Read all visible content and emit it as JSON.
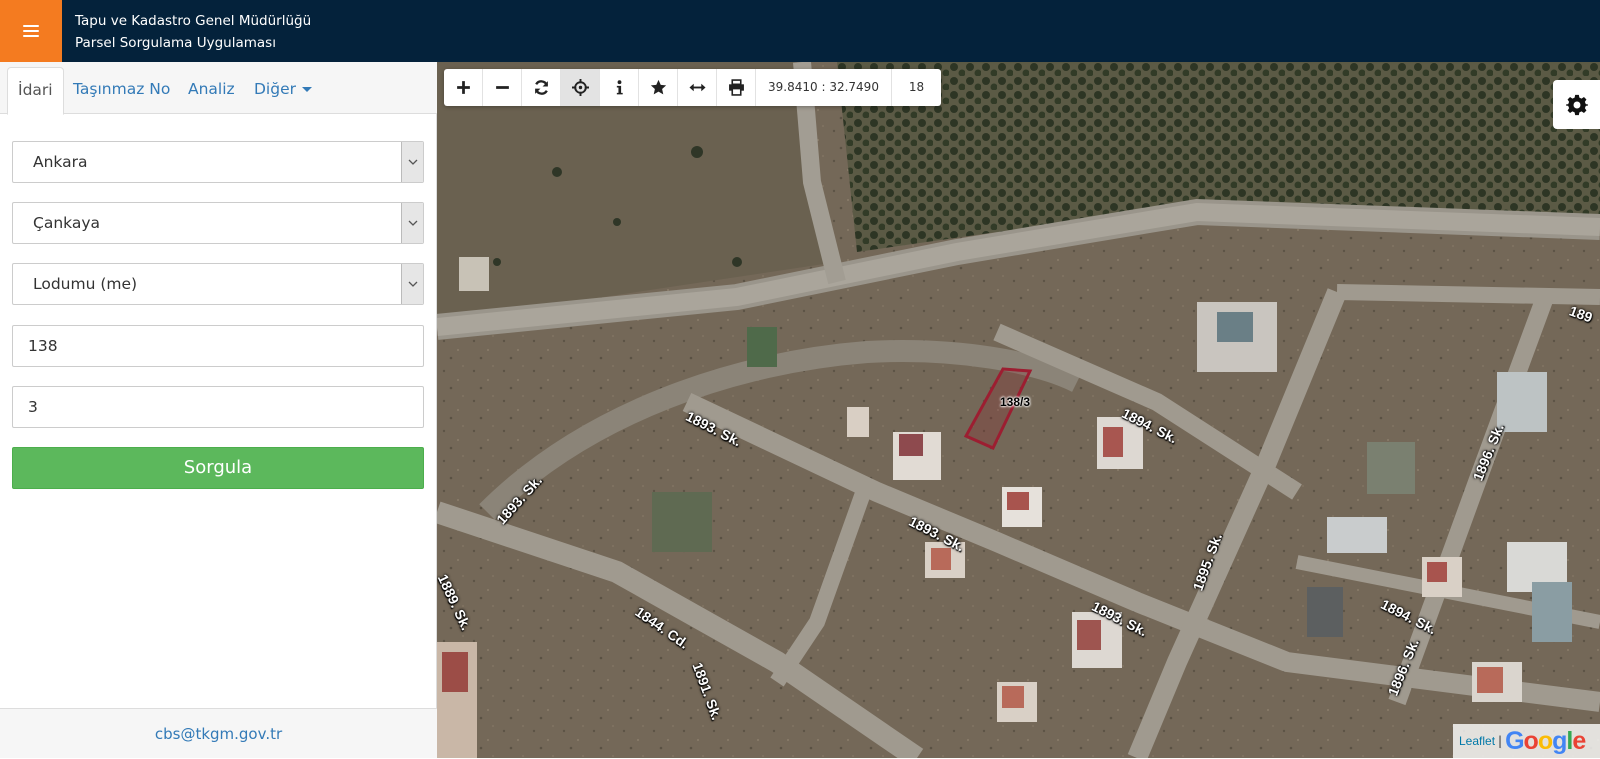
{
  "header": {
    "line1": "Tapu ve Kadastro Genel Müdürlüğü",
    "line2": "Parsel Sorgulama Uygulaması",
    "menu_icon": "hamburger-icon",
    "colors": {
      "header_bg": "#04223b",
      "menu_bg": "#f47b20"
    }
  },
  "sidebar": {
    "tabs": [
      {
        "label": "İdari",
        "active": true
      },
      {
        "label": "Taşınmaz No",
        "active": false
      },
      {
        "label": "Analiz",
        "active": false
      },
      {
        "label": "Diğer",
        "active": false
      }
    ],
    "form": {
      "il": "Ankara",
      "ilce": "Çankaya",
      "mahalle": "Lodumu (me)",
      "ada": "138",
      "parsel": "3"
    },
    "query_button": "Sorgula",
    "footer_email": "cbs@tkgm.gov.tr"
  },
  "map": {
    "coordinates": "39.8410 : 32.7490",
    "zoom": "18",
    "toolbar_icons": [
      "zoom-in-icon",
      "zoom-out-icon",
      "refresh-icon",
      "locate-icon",
      "info-icon",
      "star-icon",
      "measure-icon",
      "print-icon"
    ],
    "parcel_label": "138/3",
    "streets": {
      "s1": "1893. Sk.",
      "s2": "1893. Sk.",
      "s3": "1893. Sk.",
      "s4": "1893. Sk.",
      "s5": "1894. Sk.",
      "s6": "1894. Sk.",
      "s7": "1895. Sk.",
      "s8": "1896. Sk.",
      "s9": "1896. Sk.",
      "s10": "1844. Cd.",
      "s11": "1891. Sk.",
      "s12": "1889. Sk.",
      "s13": "189"
    },
    "attribution": {
      "leaflet": "Leaflet",
      "separator": "|",
      "google": "Google"
    }
  }
}
